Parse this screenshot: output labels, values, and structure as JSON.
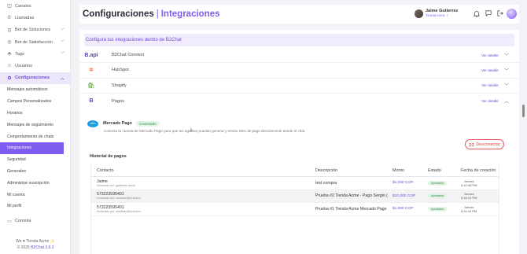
{
  "sidebar": {
    "items": [
      {
        "label": "Canales",
        "icon": "channels-icon",
        "glyph": "◫",
        "chevron": false
      },
      {
        "label": "Llamadas",
        "icon": "phone-icon",
        "glyph": "✆",
        "chevron": false
      },
      {
        "label": "Bot de Soluciones",
        "icon": "bot-icon",
        "glyph": "⊡",
        "chevron": true
      },
      {
        "label": "Bot de Satisfacción",
        "icon": "satisfaction-icon",
        "glyph": "◎",
        "chevron": true
      },
      {
        "label": "Tags",
        "icon": "tag-icon",
        "glyph": "⬘",
        "chevron": true
      },
      {
        "label": "Usuarios",
        "icon": "users-icon",
        "glyph": "☺",
        "chevron": false
      }
    ],
    "config": {
      "label": "Configuraciones",
      "icon": "settings-icon",
      "glyph": "⚙"
    },
    "subitems": [
      "Mensajes automáticos",
      "Campos Personalizados",
      "Horarios",
      "Mensajes de seguimiento",
      "Comportamiento de chats",
      "Integraciones",
      "Seguridad",
      "Generales",
      "Administrar suscripción",
      "Mi cuenta",
      "Mi perfil"
    ],
    "active_subitem": "Integraciones",
    "console": {
      "label": "Consola",
      "icon": "console-icon",
      "glyph": "▭"
    },
    "footer_line1": "We ♥ Tienda Acme ✨",
    "footer_line2_prefix": "© 2025 ",
    "footer_line2_link": "B2Chat 3.6.3"
  },
  "header": {
    "title": "Configuraciones",
    "separator": "|",
    "title_accent": "Integraciones",
    "user_name": "Jaime Gutierrez",
    "user_sub": "Tienda Acme ✓"
  },
  "main": {
    "subtitle": "Configura tus integraciones dentro de B2Chat",
    "see_detail": "Ver detalle",
    "integrations": [
      {
        "name": "B2Chat Connect",
        "logo": "B.api",
        "icon": "b2chat-api-icon",
        "color": "#5b3fd0"
      },
      {
        "name": "HubSpot",
        "logo": "✲",
        "icon": "hubspot-icon",
        "color": "#ff7a59"
      },
      {
        "name": "Shopify",
        "logo": "🛍",
        "icon": "shopify-icon",
        "color": "#7ab55c"
      },
      {
        "name": "Pagos",
        "logo": "B",
        "icon": "pagos-icon",
        "color": "#5b3fd0"
      }
    ],
    "mercado_pago": {
      "name": "Mercado Pago",
      "status": "Conectado",
      "description": "Conecta tu cuenta de Mercado Pago para que tus agentes puedan generar y enviar links de pago directamente desde el chat.",
      "disconnect_label": "Desconectar"
    },
    "history_title": "Historial de pagos",
    "table": {
      "headers": [
        "Contacto",
        "Descripción",
        "Monto",
        "Estado",
        "Fecha de creación"
      ],
      "rows": [
        {
          "contact": "Jaime",
          "sub": "Generado por: jgutierrez demo",
          "description": "test compra",
          "amount": "$1,000 COP",
          "status": "Aprobado",
          "date1": "Jueves",
          "date2": "9:10:48 PM"
        },
        {
          "contact": "573223595401",
          "sub": "Generado por: nandhax@b2chat.io",
          "description": "Prueba #2 Tienda Acme - Pago Sergio (",
          "amount": "$10,000 COP",
          "status": "Aprobado",
          "date1": "Jueves",
          "date2": "5:18:14 PM"
        },
        {
          "contact": "573223595401",
          "sub": "Generado por: nandhax@b2chat.io",
          "description": "Prueba #1 Tienda Acme Mercado Pago",
          "amount": "$1,000 COP",
          "status": "Aprobado",
          "date1": "Jueves",
          "date2": "5:11:44 PM"
        }
      ]
    }
  },
  "colors": {
    "accent": "#7e5cf0",
    "success": "#2a8a3e",
    "danger": "#d94242"
  }
}
